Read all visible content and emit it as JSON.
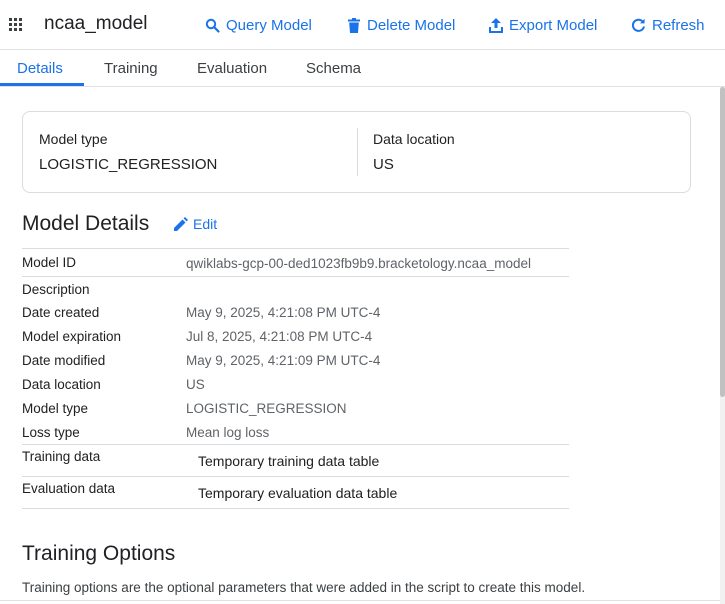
{
  "header": {
    "title": "ncaa_model",
    "actions": {
      "query": "Query Model",
      "delete": "Delete Model",
      "export": "Export Model",
      "refresh": "Refresh"
    }
  },
  "tabs": [
    "Details",
    "Training",
    "Evaluation",
    "Schema"
  ],
  "summary": {
    "model_type_label": "Model type",
    "model_type_value": "LOGISTIC_REGRESSION",
    "data_location_label": "Data location",
    "data_location_value": "US"
  },
  "details": {
    "title": "Model Details",
    "edit_label": "Edit",
    "rows": [
      {
        "label": "Model ID",
        "value": "qwiklabs-gcp-00-ded1023fb9b9.bracketology.ncaa_model"
      },
      {
        "label": "Description",
        "value": ""
      },
      {
        "label": "Date created",
        "value": "May 9, 2025, 4:21:08 PM UTC-4"
      },
      {
        "label": "Model expiration",
        "value": "Jul 8, 2025, 4:21:08 PM UTC-4"
      },
      {
        "label": "Date modified",
        "value": "May 9, 2025, 4:21:09 PM UTC-4"
      },
      {
        "label": "Data location",
        "value": "US"
      },
      {
        "label": "Model type",
        "value": "LOGISTIC_REGRESSION"
      },
      {
        "label": "Loss type",
        "value": "Mean log loss"
      },
      {
        "label": "Training data",
        "value": "Temporary training data table"
      },
      {
        "label": "Evaluation data",
        "value": "Temporary evaluation data table"
      }
    ]
  },
  "training_options": {
    "title": "Training Options",
    "description": "Training options are the optional parameters that were added in the script to create this model."
  },
  "colors": {
    "accent": "#1a73e8",
    "text": "#202124",
    "muted": "#5f6368",
    "border": "#dadce0"
  }
}
